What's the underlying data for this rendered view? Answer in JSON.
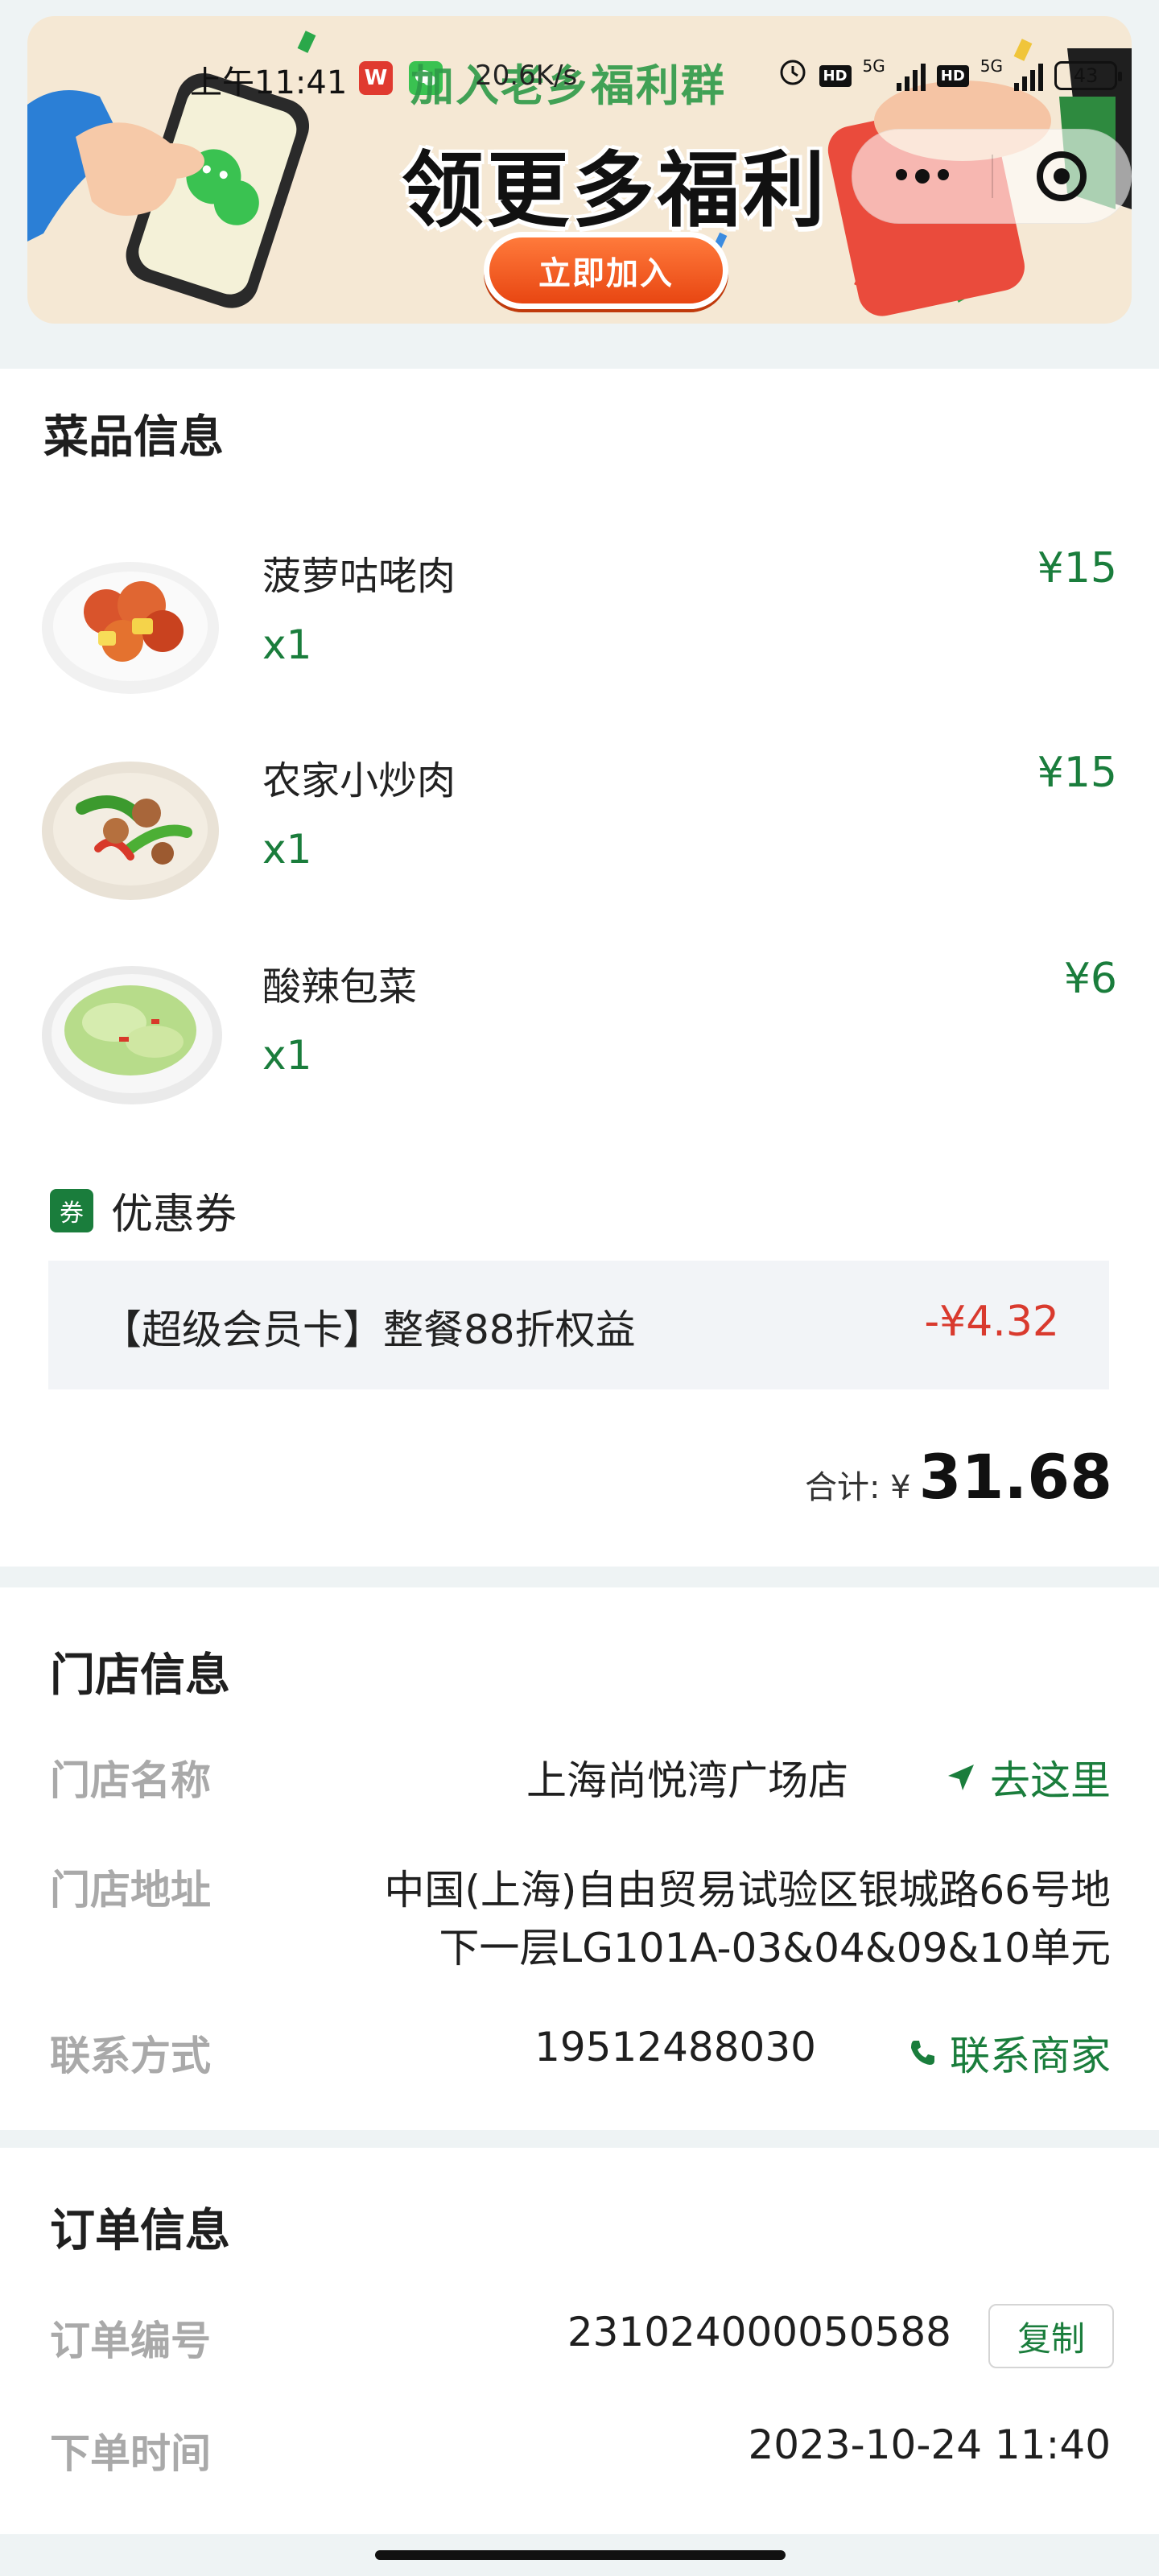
{
  "statusbar": {
    "time": "上午11:41",
    "app_badge_w": "W",
    "overlay_title": "加入老乡福利群",
    "speed": "20.6K/s",
    "hd1": "HD",
    "hd2": "HD",
    "net1": "5G",
    "net2": "5G",
    "battery": "43"
  },
  "banner": {
    "headline": "领更多福利",
    "join_button": "立即加入"
  },
  "dishes_section": {
    "title": "菜品信息",
    "items": [
      {
        "name": "菠萝咕咾肉",
        "qty": "x1",
        "price": "¥15"
      },
      {
        "name": "农家小炒肉",
        "qty": "x1",
        "price": "¥15"
      },
      {
        "name": "酸辣包菜",
        "qty": "x1",
        "price": "¥6"
      }
    ]
  },
  "coupon": {
    "icon_char": "券",
    "label": "优惠券",
    "description": "【超级会员卡】整餐88折权益",
    "amount": "-¥4.32"
  },
  "total": {
    "label": "合计: ¥",
    "value": "31.68"
  },
  "store": {
    "title": "门店信息",
    "name_label": "门店名称",
    "name_value": "上海尚悦湾广场店",
    "navigate": "去这里",
    "address_label": "门店地址",
    "address_line1": "中国(上海)自由贸易试验区银城路66号地",
    "address_line2": "下一层LG101A-03&04&09&10单元",
    "contact_label": "联系方式",
    "phone": "19512488030",
    "contact_merchant": "联系商家"
  },
  "order": {
    "title": "订单信息",
    "number_label": "订单编号",
    "number_value": "231024000050588",
    "copy": "复制",
    "time_label": "下单时间",
    "time_value": "2023-10-24 11:40"
  },
  "colors": {
    "accent_green": "#1a7d3c",
    "discount_red": "#d93a2e",
    "banner_bg": "#f5e8d4"
  }
}
